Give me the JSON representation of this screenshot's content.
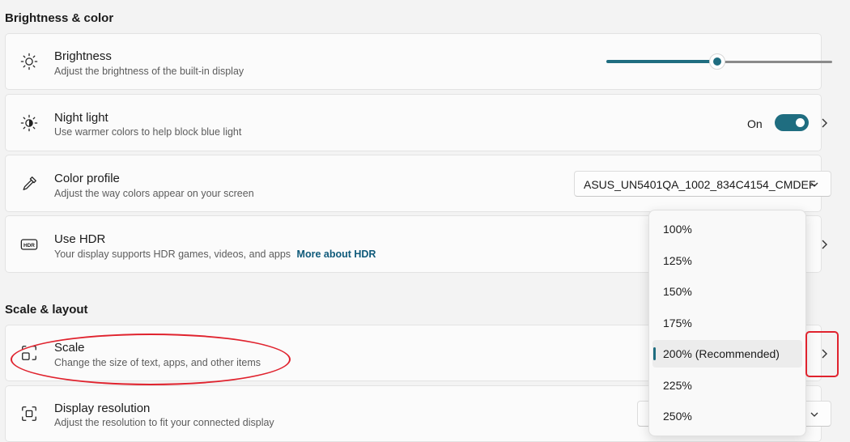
{
  "sections": {
    "brightness_color": "Brightness & color",
    "scale_layout": "Scale & layout"
  },
  "brightness": {
    "title": "Brightness",
    "desc": "Adjust the brightness of the built-in display",
    "level_fraction": 0.49
  },
  "night_light": {
    "title": "Night light",
    "desc": "Use warmer colors to help block blue light",
    "state": "On"
  },
  "color_profile": {
    "title": "Color profile",
    "desc": "Adjust the way colors appear on your screen",
    "selected": "ASUS_UN5401QA_1002_834C4154_CMDEF"
  },
  "hdr": {
    "title": "Use HDR",
    "desc": "Your display supports HDR games, videos, and apps",
    "link": "More about HDR"
  },
  "scale": {
    "title": "Scale",
    "desc": "Change the size of text, apps, and other items"
  },
  "display_resolution": {
    "title": "Display resolution",
    "desc": "Adjust the resolution to fit your connected display"
  },
  "scale_options": [
    "100%",
    "125%",
    "150%",
    "175%",
    "200% (Recommended)",
    "225%",
    "250%"
  ],
  "scale_selected_index": 4,
  "colors": {
    "accent": "#1f6d80",
    "annotation": "#e0232e"
  },
  "icons": {
    "brightness": "sun-icon",
    "night_light": "night-light-icon",
    "color_profile": "eyedropper-icon",
    "hdr": "hdr-icon",
    "scale": "scale-icon",
    "display_resolution": "resolution-icon"
  }
}
